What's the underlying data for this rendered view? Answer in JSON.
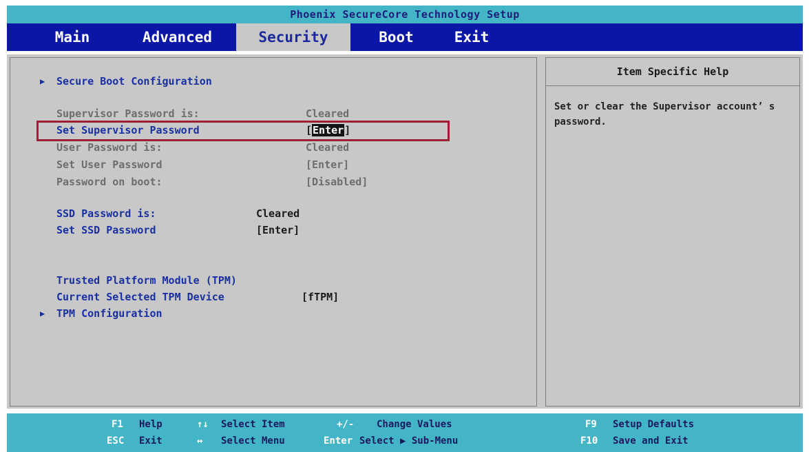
{
  "title": "Phoenix SecureCore Technology Setup",
  "menu": {
    "tabs": [
      "Main",
      "Advanced",
      "Security",
      "Boot",
      "Exit"
    ],
    "active": "Security"
  },
  "security": {
    "secure_boot_config": "Secure Boot Configuration",
    "supervisor_status_label": "Supervisor Password is:",
    "supervisor_status_value": "Cleared",
    "set_supervisor_label": "Set Supervisor Password",
    "set_supervisor_value": "Enter",
    "user_status_label": "User Password is:",
    "user_status_value": "Cleared",
    "set_user_label": "Set User Password",
    "set_user_value": "[Enter]",
    "password_on_boot_label": "Password on boot:",
    "password_on_boot_value": "[Disabled]",
    "ssd_status_label": "SSD Password is:",
    "ssd_status_value": "Cleared",
    "set_ssd_label": "Set SSD Password",
    "set_ssd_value": "[Enter]",
    "tpm_label": "Trusted Platform Module (TPM)",
    "tpm_device_label": "Current Selected TPM Device",
    "tpm_device_value": "[fTPM]",
    "tpm_config": "TPM Configuration"
  },
  "help": {
    "title": "Item Specific Help",
    "text": "Set or clear the Supervisor account’ s password."
  },
  "footer": {
    "f1_key": "F1",
    "f1_label": "Help",
    "updown_key": "↑↓",
    "updown_label": "Select Item",
    "plusminus_key": "+/-",
    "plusminus_label": "Change Values",
    "f9_key": "F9",
    "f9_label": "Setup Defaults",
    "esc_key": "ESC",
    "esc_label": "Exit",
    "leftright_key": "↔",
    "leftright_label": "Select Menu",
    "enter_key": "Enter",
    "enter_label": "Select ▶ Sub-Menu",
    "f10_key": "F10",
    "f10_label": "Save and Exit"
  },
  "colors": {
    "title_bar": "#44b4c7",
    "menu_bar": "#0a16a6",
    "panel": "#c8c8c8",
    "highlight_border": "#9c1f33",
    "label_blue": "#1a2fa0"
  }
}
